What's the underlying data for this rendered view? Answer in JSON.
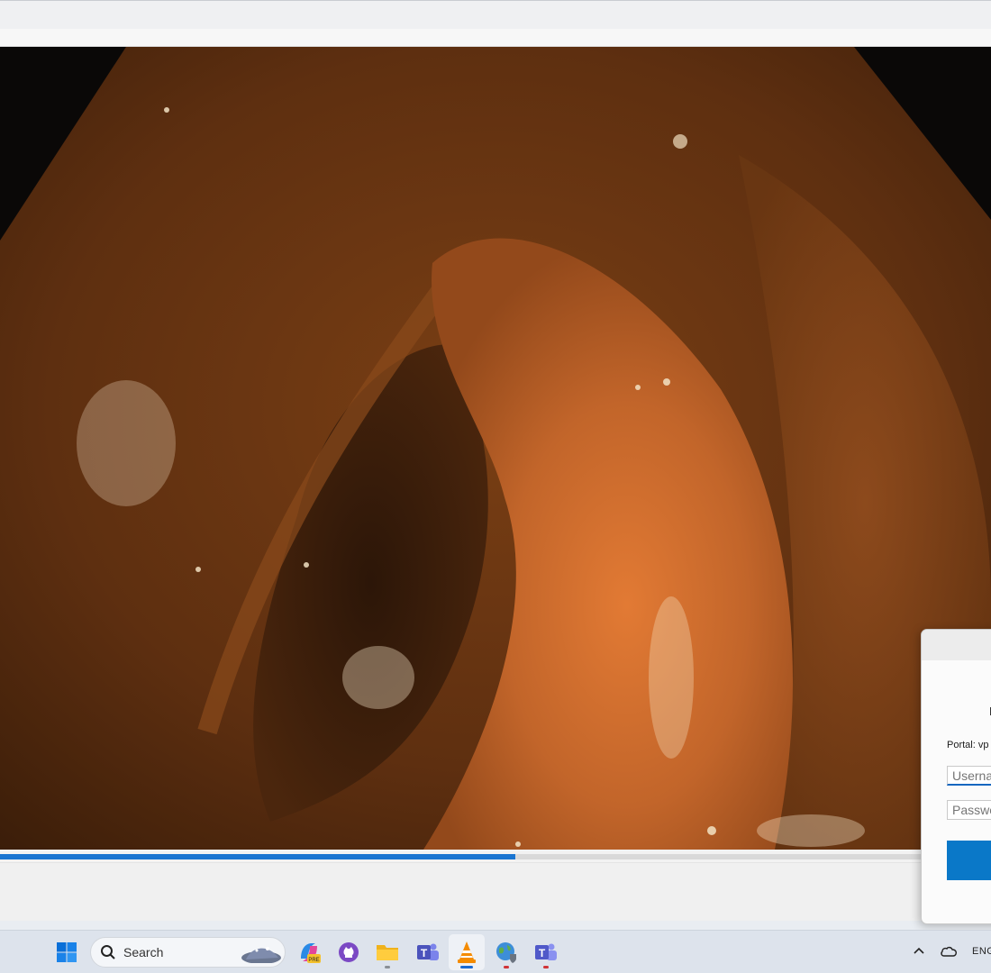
{
  "player": {
    "progress": 0.52
  },
  "vpn_dialog": {
    "portal_label": "Portal: vp",
    "username_placeholder": "Userna",
    "password_placeholder": "Passwo"
  },
  "taskbar": {
    "search_label": "Search",
    "apps": [
      "windows-start",
      "copilot-preview",
      "github-desktop",
      "file-explorer",
      "teams-classic",
      "vlc-media-player",
      "vpn-globe",
      "microsoft-teams"
    ],
    "tray": {
      "language": "ENG"
    }
  },
  "colors": {
    "accent": "#1a75d1",
    "tissue": "#8a4a1c",
    "taskbar": "#dde3ec"
  }
}
